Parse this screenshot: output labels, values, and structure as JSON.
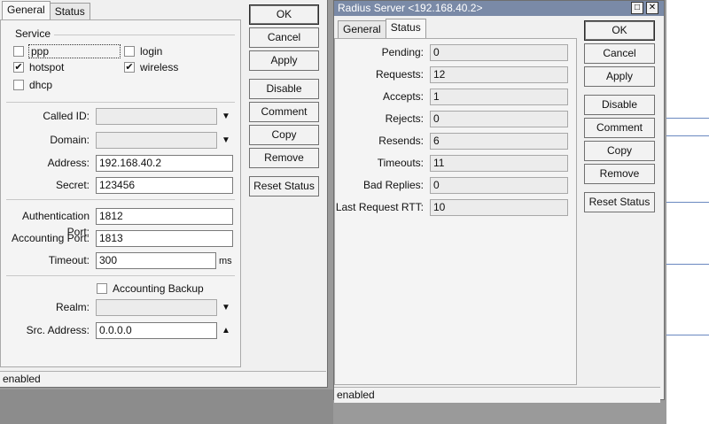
{
  "left_window": {
    "tabs": [
      "General",
      "Status"
    ],
    "service_group_title": "Service",
    "services": [
      {
        "label": "ppp",
        "checked": false
      },
      {
        "label": "login",
        "checked": false
      },
      {
        "label": "hotspot",
        "checked": true
      },
      {
        "label": "wireless",
        "checked": true
      },
      {
        "label": "dhcp",
        "checked": false
      }
    ],
    "fields": {
      "called_id": {
        "label": "Called ID:",
        "value": ""
      },
      "domain": {
        "label": "Domain:",
        "value": ""
      },
      "address": {
        "label": "Address:",
        "value": "192.168.40.2"
      },
      "secret": {
        "label": "Secret:",
        "value": "123456"
      },
      "auth_port": {
        "label": "Authentication Port:",
        "value": "1812"
      },
      "acct_port": {
        "label": "Accounting Port:",
        "value": "1813"
      },
      "timeout": {
        "label": "Timeout:",
        "value": "300",
        "unit": "ms"
      },
      "accounting_backup": {
        "label": "Accounting Backup",
        "checked": false
      },
      "realm": {
        "label": "Realm:",
        "value": ""
      },
      "src_address": {
        "label": "Src. Address:",
        "value": "0.0.0.0"
      }
    },
    "buttons": [
      "OK",
      "Cancel",
      "Apply",
      "Disable",
      "Comment",
      "Copy",
      "Remove",
      "Reset Status"
    ],
    "status_text": "enabled"
  },
  "right_window": {
    "title": "Radius Server <192.168.40.2>",
    "tabs": [
      "General",
      "Status"
    ],
    "stats": [
      {
        "label": "Pending:",
        "value": "0"
      },
      {
        "label": "Requests:",
        "value": "12"
      },
      {
        "label": "Accepts:",
        "value": "1"
      },
      {
        "label": "Rejects:",
        "value": "0"
      },
      {
        "label": "Resends:",
        "value": "6"
      },
      {
        "label": "Timeouts:",
        "value": "11"
      },
      {
        "label": "Bad Replies:",
        "value": "0"
      },
      {
        "label": "Last Request RTT:",
        "value": "10"
      }
    ],
    "buttons": [
      "OK",
      "Cancel",
      "Apply",
      "Disable",
      "Comment",
      "Copy",
      "Remove",
      "Reset Status"
    ],
    "status_text": "enabled"
  },
  "colors": {
    "titlebar": "#7a8aa7",
    "window_bg": "#f0f0f0",
    "desktop": "#9a9a9a"
  }
}
